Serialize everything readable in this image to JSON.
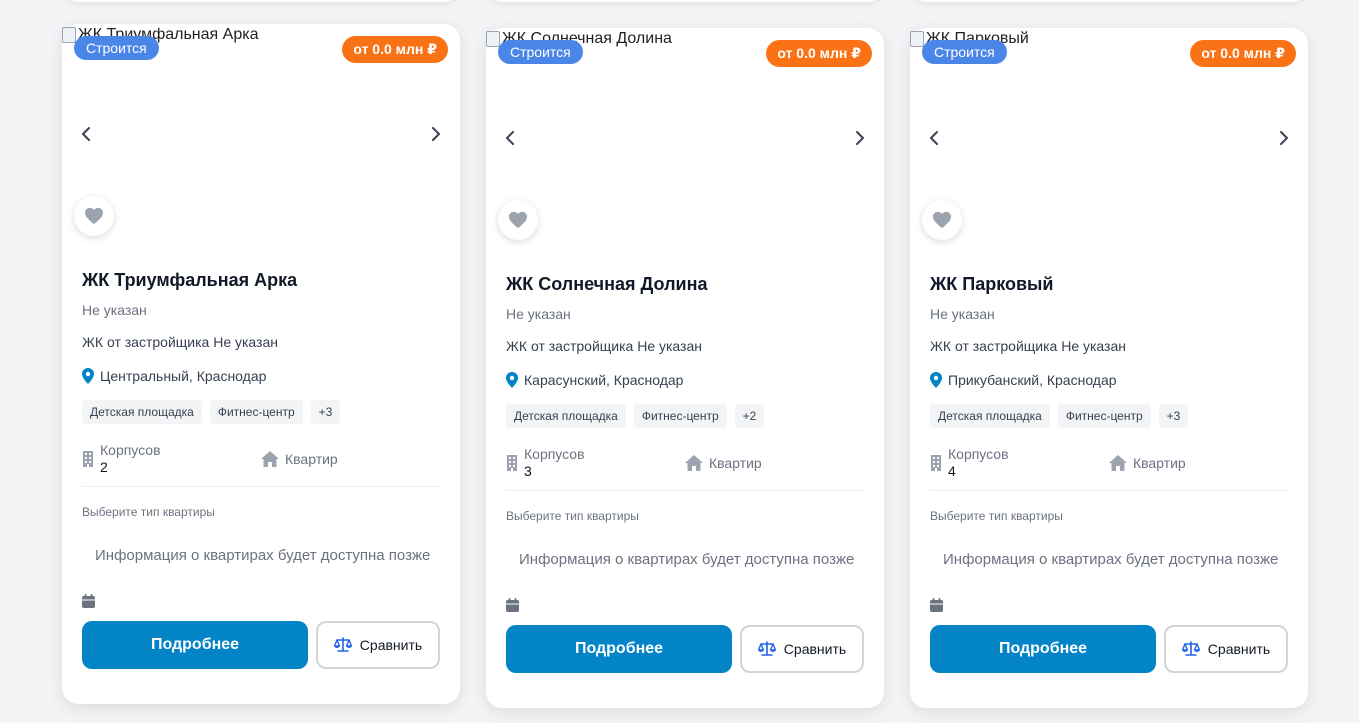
{
  "cards": [
    {
      "image_alt": "ЖК Триумфальная Арка",
      "status": "Строится",
      "price": "от 0.0 млн ₽",
      "title": "ЖК Триумфальная Арка",
      "class_text": "Не указан",
      "developer": "ЖК от застройщика Не указан",
      "location": "Центральный, Краснодар",
      "tags": [
        "Детская площадка",
        "Фитнес-центр",
        "+3"
      ],
      "buildings_label": "Корпусов",
      "buildings_value": "2",
      "apartments_label": "Квартир",
      "select_label": "Выберите тип квартиры",
      "info_note": "Информация о квартирах будет доступна позже",
      "details_button": "Подробнее",
      "compare_button": "Сравнить"
    },
    {
      "image_alt": "ЖК Солнечная Долина",
      "status": "Строится",
      "price": "от 0.0 млн ₽",
      "title": "ЖК Солнечная Долина",
      "class_text": "Не указан",
      "developer": "ЖК от застройщика Не указан",
      "location": "Карасунский, Краснодар",
      "tags": [
        "Детская площадка",
        "Фитнес-центр",
        "+2"
      ],
      "buildings_label": "Корпусов",
      "buildings_value": "3",
      "apartments_label": "Квартир",
      "select_label": "Выберите тип квартиры",
      "info_note": "Информация о квартирах будет доступна позже",
      "details_button": "Подробнее",
      "compare_button": "Сравнить"
    },
    {
      "image_alt": "ЖК Парковый",
      "status": "Строится",
      "price": "от 0.0 млн ₽",
      "title": "ЖК Парковый",
      "class_text": "Не указан",
      "developer": "ЖК от застройщика Не указан",
      "location": "Прикубанский, Краснодар",
      "tags": [
        "Детская площадка",
        "Фитнес-центр",
        "+3"
      ],
      "buildings_label": "Корпусов",
      "buildings_value": "4",
      "apartments_label": "Квартир",
      "select_label": "Выберите тип квартиры",
      "info_note": "Информация о квартирах будет доступна позже",
      "details_button": "Подробнее",
      "compare_button": "Сравнить"
    }
  ],
  "icons": {
    "prev": "chevron-left-icon",
    "next": "chevron-right-icon",
    "favorite": "heart-icon",
    "location": "map-pin-icon",
    "buildings": "building-icon",
    "apartments": "home-icon",
    "calendar": "calendar-icon",
    "compare": "scales-icon"
  },
  "colors": {
    "status_badge": "#4a86e8",
    "price_badge": "#f97316",
    "primary_button": "#0284c7",
    "pin": "#0284c7",
    "compare_icon": "#2563eb"
  }
}
